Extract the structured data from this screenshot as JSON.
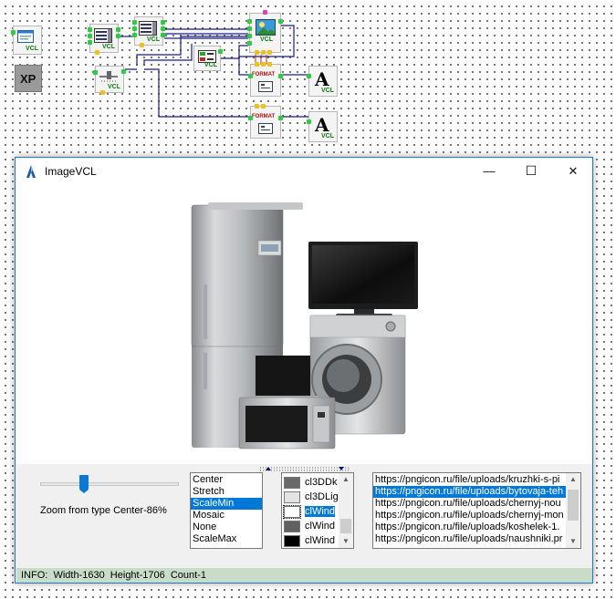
{
  "scheme": {
    "components": [
      {
        "id": "formVCL",
        "label": "VCL"
      },
      {
        "id": "xpStyle",
        "label": "XP"
      },
      {
        "id": "listVCL1",
        "label": "VCL"
      },
      {
        "id": "listVCL2",
        "label": "VCL"
      },
      {
        "id": "imageVCL",
        "label": "VCL"
      },
      {
        "id": "trackVCL",
        "label": "VCL"
      },
      {
        "id": "colorVCL",
        "label": "VCL"
      },
      {
        "id": "format1",
        "label": "FORMAT"
      },
      {
        "id": "format2",
        "label": "FORMAT"
      },
      {
        "id": "labelVCL1",
        "label": "VCL"
      },
      {
        "id": "labelVCL2",
        "label": "VCL"
      }
    ]
  },
  "window": {
    "title": "ImageVCL",
    "minimize_glyph": "—",
    "maximize_glyph": "☐",
    "close_glyph": "✕"
  },
  "image": {
    "alt_subject": "home-appliances-photo"
  },
  "trackbar": {
    "value_percent": 30
  },
  "zoom_label": "Zoom from type Center-86%",
  "type_list": {
    "items": [
      "Center",
      "Stretch",
      "ScaleMin",
      "Mosaic",
      "None",
      "ScaleMax"
    ],
    "selected_index": 2
  },
  "color_list": {
    "items": [
      {
        "name": "cl3DDk",
        "color": "#696969"
      },
      {
        "name": "cl3DLig",
        "color": "#e3e3e3"
      },
      {
        "name": "clWind",
        "color": "#ffffff"
      },
      {
        "name": "clWind",
        "color": "#606060"
      },
      {
        "name": "clWind",
        "color": "#000000"
      }
    ],
    "selected_index": 2
  },
  "url_list": {
    "items": [
      "https://pngicon.ru/file/uploads/kruzhki-s-pi",
      "https://pngicon.ru/file/uploads/bytovaja-teh",
      "https://pngicon.ru/file/uploads/chernyj-nou",
      "https://pngicon.ru/file/uploads/chernyj-mon",
      "https://pngicon.ru/file/uploads/koshelek-1.",
      "https://pngicon.ru/file/uploads/naushniki.pr"
    ],
    "selected_index": 1
  },
  "status": {
    "text": "INFO:  Width-1630  Height-1706  Count-1"
  },
  "colors": {
    "accent": "#0078d7",
    "status_bg": "#c8dcc8",
    "vcl_green": "#0a7a0a",
    "pin_green": "#2ecc40",
    "wire_blue": "#1a1a8c"
  }
}
